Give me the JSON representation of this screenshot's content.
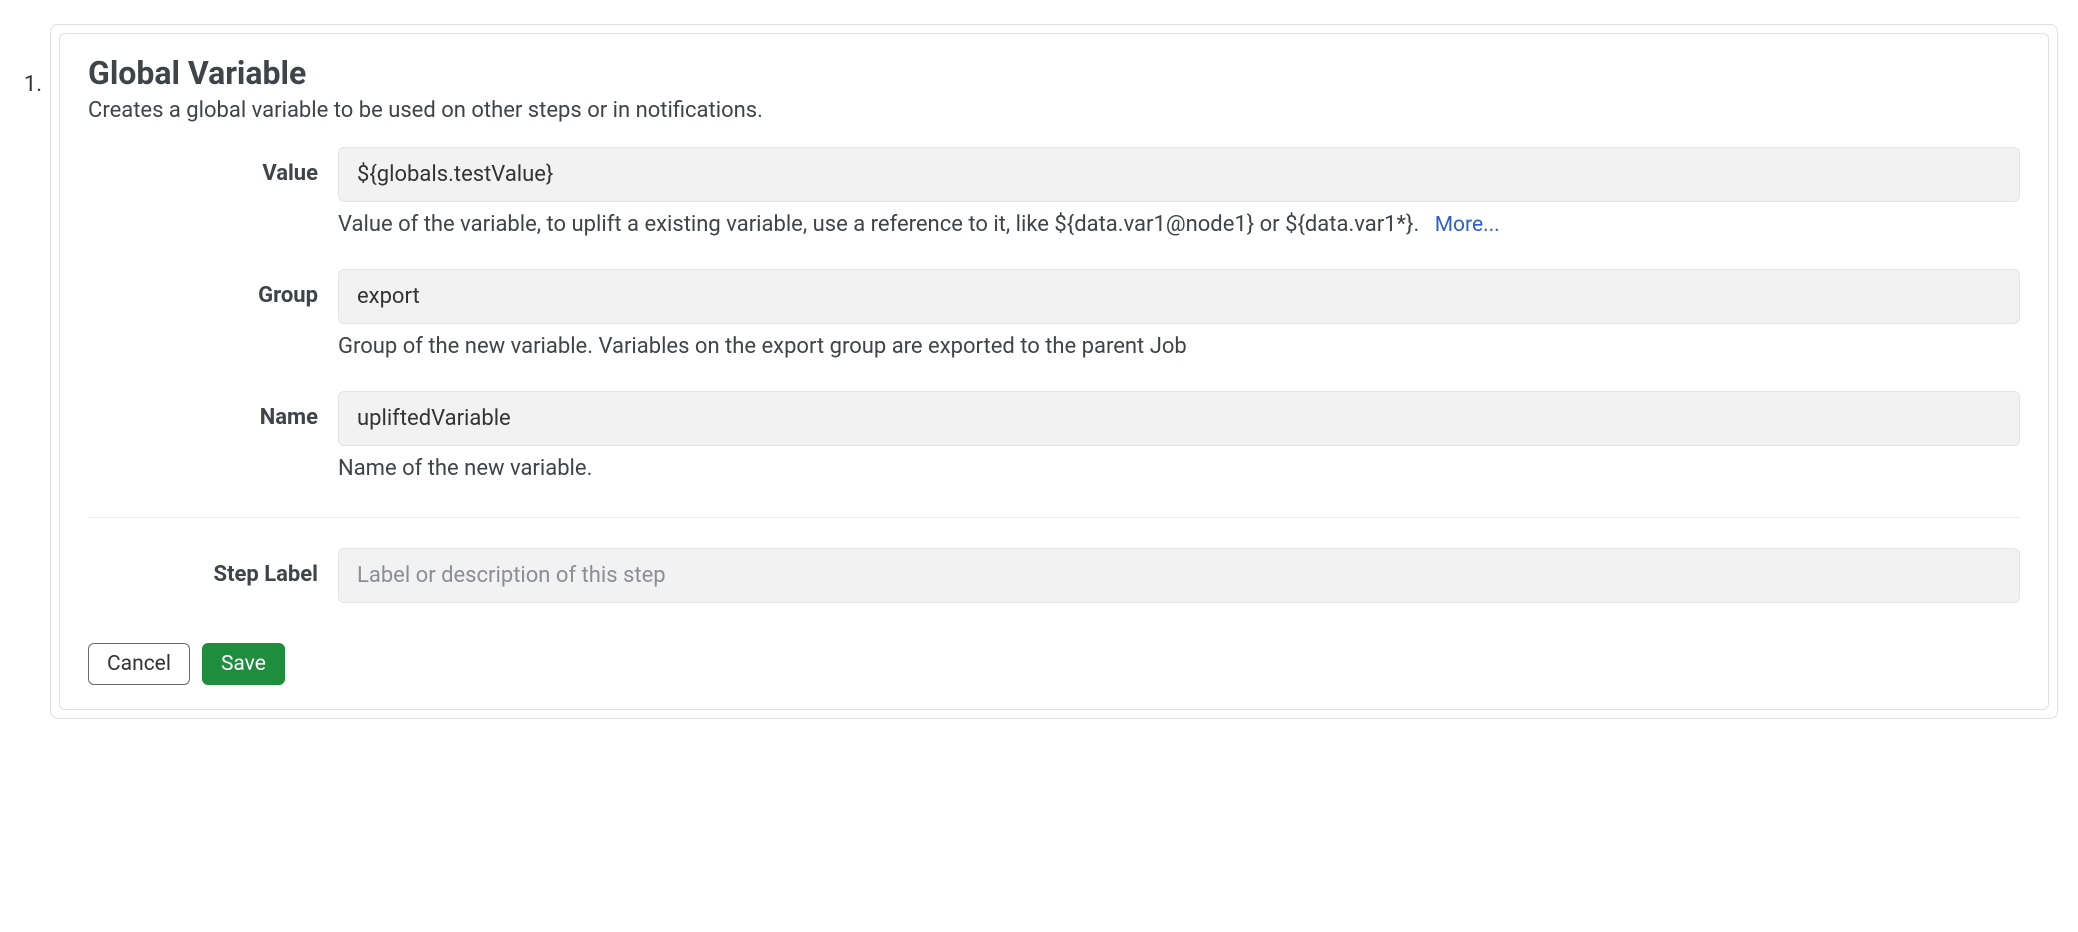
{
  "list_number": "1.",
  "panel": {
    "title": "Global Variable",
    "subtitle": "Creates a global variable to be used on other steps or in notifications."
  },
  "fields": {
    "value": {
      "label": "Value",
      "value": "${globals.testValue}",
      "help": "Value of the variable, to uplift a existing variable, use a reference to it, like ${data.var1@node1} or ${data.var1*}.",
      "more_link": "More..."
    },
    "group": {
      "label": "Group",
      "value": "export",
      "help": "Group of the new variable. Variables on the export group are exported to the parent Job"
    },
    "name": {
      "label": "Name",
      "value": "upliftedVariable",
      "help": "Name of the new variable."
    },
    "step_label": {
      "label": "Step Label",
      "value": "",
      "placeholder": "Label or description of this step"
    }
  },
  "buttons": {
    "cancel": "Cancel",
    "save": "Save"
  }
}
